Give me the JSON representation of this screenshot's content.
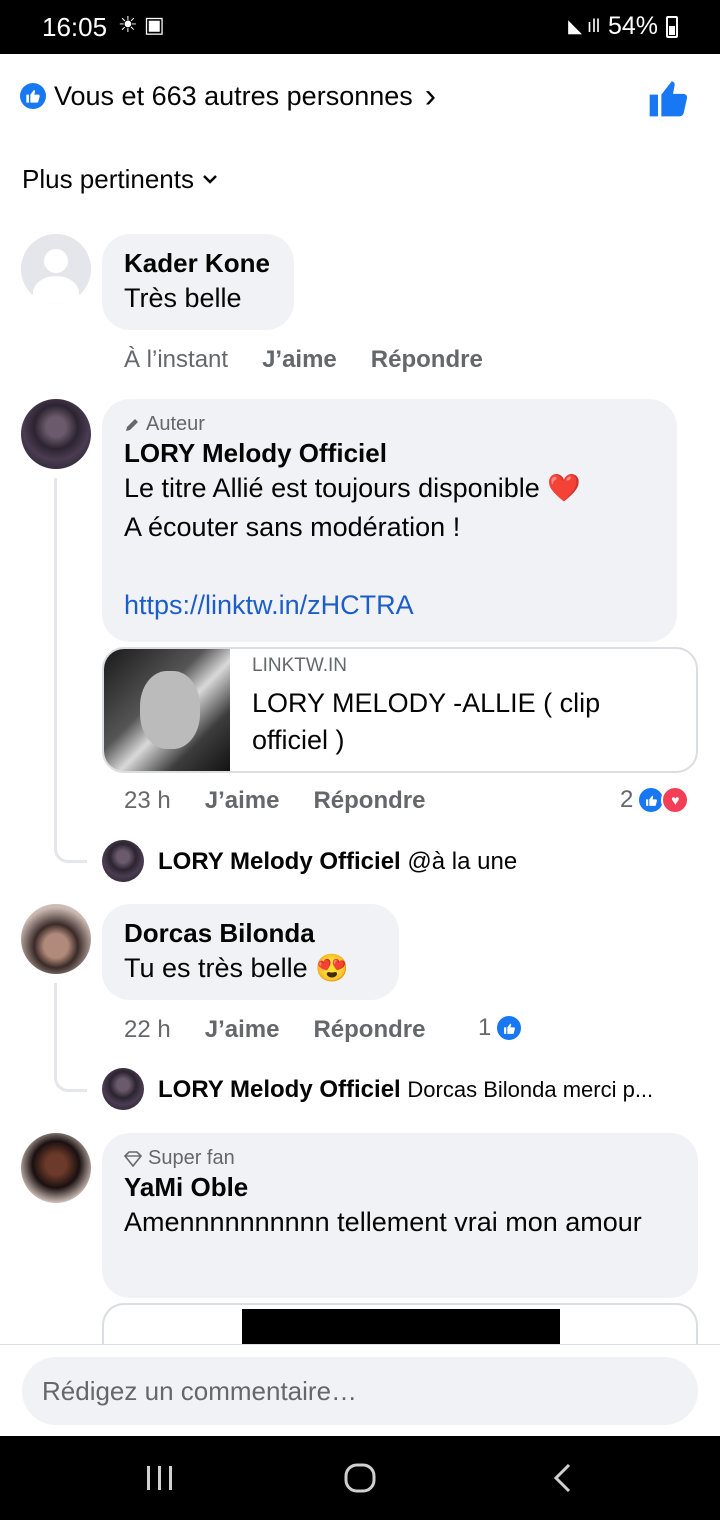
{
  "status_bar": {
    "time": "16:05",
    "battery": "54%",
    "left_icons": "☀ ▣",
    "signal": "◣ ıll"
  },
  "reactions_summary": {
    "text": "Vous et 663 autres personnes",
    "chevron": "›"
  },
  "sort": {
    "label": "Plus pertinents"
  },
  "comments": [
    {
      "name": "Kader Kone",
      "text": "Très belle",
      "time": "À l’instant",
      "like": "J’aime",
      "reply": "Répondre"
    },
    {
      "badge": "Auteur",
      "name": "LORY Melody Officiel",
      "line1": "Le titre Allié est toujours disponible ❤️",
      "line2": "A écouter sans modération !",
      "link": "https://linktw.in/zHCTRA",
      "card": {
        "domain": "LINKTW.IN",
        "title": "LORY MELODY -ALLIE ( clip officiel )"
      },
      "time": "23 h",
      "like": "J’aime",
      "reply": "Répondre",
      "reaction_count": "2",
      "reply_row": {
        "name": "LORY Melody Officiel",
        "text": "@à la une"
      }
    },
    {
      "name": "Dorcas Bilonda",
      "text": "Tu es très belle 😍",
      "time": "22 h",
      "like": "J’aime",
      "reply": "Répondre",
      "reaction_count": "1",
      "reply_row": {
        "name": "LORY Melody Officiel",
        "text": "Dorcas Bilonda merci p..."
      }
    },
    {
      "badge": "Super fan",
      "name": "YaMi Oble",
      "text": "Amennnnnnnnnn tellement vrai mon amour"
    }
  ],
  "composer": {
    "placeholder": "Rédigez un commentaire…"
  },
  "colors": {
    "accent": "#1877f2",
    "bubble": "#f0f2f5",
    "secondary_text": "#65676b",
    "link": "#1b5ec9"
  }
}
